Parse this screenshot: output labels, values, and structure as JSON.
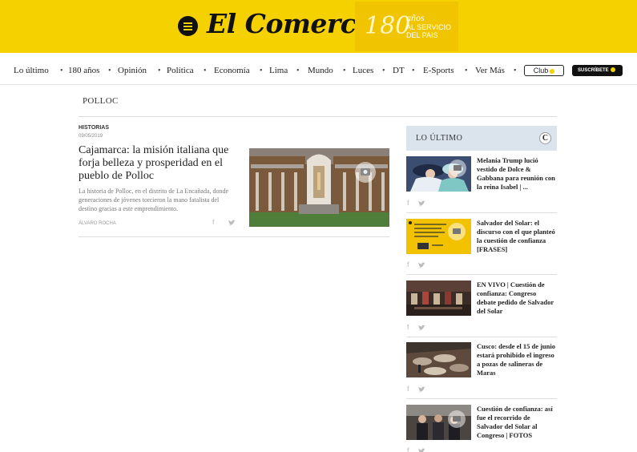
{
  "header": {
    "logo_text": "El Comercio",
    "anniversary_number": "180",
    "anniversary_anos": "años",
    "anniversary_line1": "AL SERVICIO",
    "anniversary_line2": "DEL PAIS"
  },
  "nav": {
    "items": [
      "Lo último",
      "180 años",
      "Opinión",
      "Política",
      "Economía",
      "Lima",
      "Mundo",
      "Luces",
      "DT",
      "E-Sports",
      "Ver Más"
    ],
    "club_label": "Club",
    "subscribe_label": "SUSCRÍBETE"
  },
  "page": {
    "title": "POLLOC"
  },
  "article": {
    "section": "HISTORIAS",
    "date": "09/05/2019",
    "headline": "Cajamarca: la misión italiana que forja belleza y prosperidad en el pueblo de Polloc",
    "summary": "La historia de Polloc, en el distrito de La Encañada, donde generaciones de jóvenes torcieron la mano fatalista del destino gracias a este emprendimiento.",
    "author": "ÁLVARO ROCHA",
    "facebook_glyph": "f"
  },
  "sidebar": {
    "heading": "LO ÚLTIMO",
    "badge": "C",
    "items": [
      {
        "title": "Melania Trump lució vestido de Dolce & Gabbana para reunión con la reina Isabel | ..."
      },
      {
        "title": "Salvador del Solar: el discurso con el que planteó la cuestión de confianza [FRASES]"
      },
      {
        "title": "EN VIVO | Cuestión de confianza: Congreso debate pedido de Salvador del Solar"
      },
      {
        "title": "Cusco: desde el 15 de junio estará prohibido el ingreso a pozas de salineras de Maras"
      },
      {
        "title": "Cuestión de confianza: así fue el recorrido de Salvador del Solar al Congreso | FOTOS"
      }
    ]
  },
  "colors": {
    "brand_yellow": "#f5d100",
    "sidebar_header": "#dbe4ec"
  },
  "icons": {
    "menu": "menu-icon",
    "camera": "camera-icon",
    "facebook": "facebook-icon",
    "twitter": "twitter-icon"
  }
}
